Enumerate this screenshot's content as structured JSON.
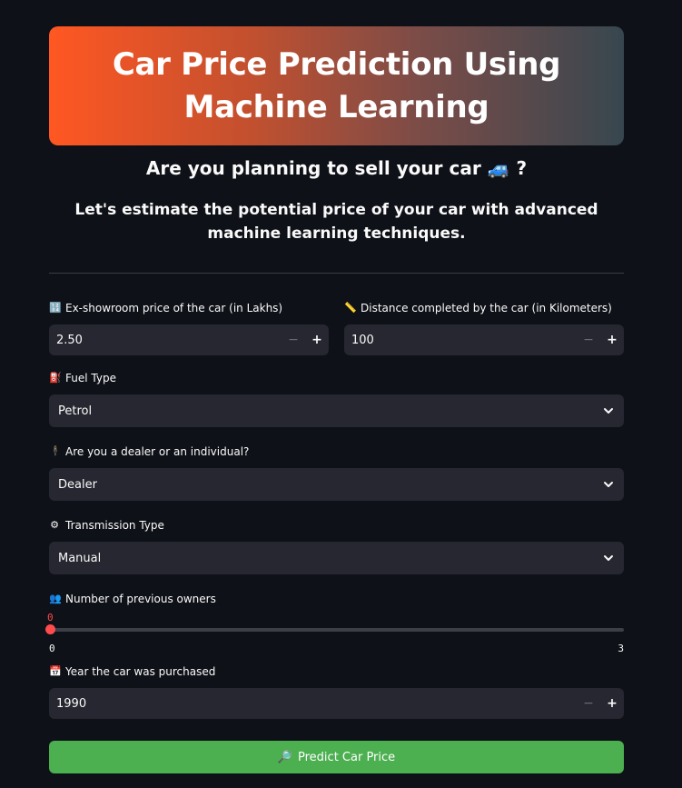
{
  "header": {
    "title": "Car Price Prediction Using Machine Learning",
    "question": "Are you planning to sell your car",
    "question_emoji": "🚙",
    "question_mark": "?",
    "subtitle": "Let's estimate the potential price of your car with advanced machine learning techniques."
  },
  "form": {
    "price": {
      "icon": "🔢",
      "label": "Ex-showroom price of the car (in Lakhs)",
      "value": "2.50"
    },
    "distance": {
      "icon": "📏",
      "label": "Distance completed by the car (in Kilometers)",
      "value": "100"
    },
    "fuel": {
      "icon": "⛽",
      "label": "Fuel Type",
      "value": "Petrol"
    },
    "seller": {
      "icon": "🕴",
      "label": "Are you a dealer or an individual?",
      "value": "Dealer"
    },
    "transmission": {
      "icon": "⚙",
      "label": "Transmission Type",
      "value": "Manual"
    },
    "owners": {
      "icon": "👥",
      "label": "Number of previous owners",
      "value": "0",
      "min": "0",
      "max": "3",
      "fraction": 0
    },
    "year": {
      "icon": "📅",
      "label": "Year the car was purchased",
      "value": "1990"
    },
    "stepper": {
      "minus": "−",
      "plus": "+"
    }
  },
  "actions": {
    "predict_icon": "🔎",
    "predict_label": "Predict Car Price"
  },
  "colors": {
    "background": "#0e1117",
    "input": "#262730",
    "accent": "#ff4b4b",
    "button": "#4caf50",
    "gradient_start": "#ff5722",
    "gradient_end": "#37474f"
  }
}
